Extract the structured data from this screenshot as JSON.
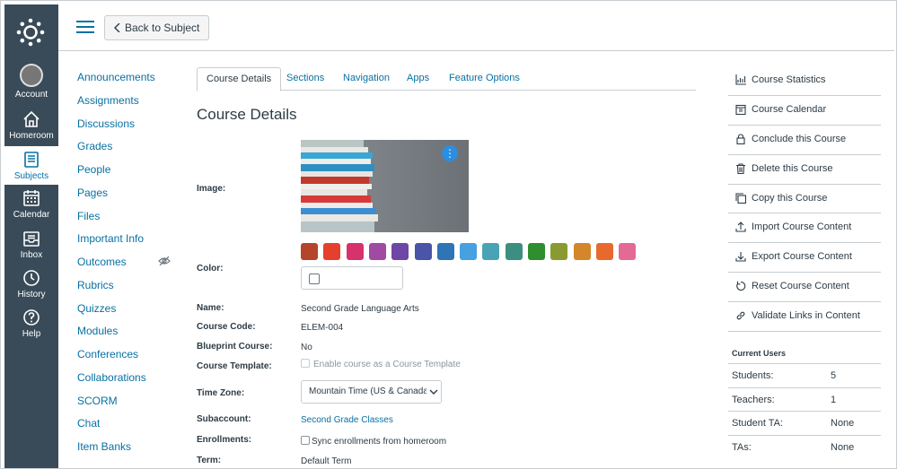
{
  "global_nav": {
    "items": [
      {
        "label": "Account",
        "icon": "avatar"
      },
      {
        "label": "Homeroom",
        "icon": "home-icon"
      },
      {
        "label": "Subjects",
        "icon": "book-icon",
        "active": true
      },
      {
        "label": "Calendar",
        "icon": "calendar-icon"
      },
      {
        "label": "Inbox",
        "icon": "inbox-icon"
      },
      {
        "label": "History",
        "icon": "clock-icon"
      },
      {
        "label": "Help",
        "icon": "help-icon"
      }
    ],
    "colors": {
      "background": "#394b58",
      "active_text": "#0770a3"
    }
  },
  "topbar": {
    "back_label": "Back to Subject"
  },
  "course_nav": [
    "Announcements",
    "Assignments",
    "Discussions",
    "Grades",
    "People",
    "Pages",
    "Files",
    "Important Info",
    "Outcomes",
    "Rubrics",
    "Quizzes",
    "Modules",
    "Conferences",
    "Collaborations",
    "SCORM",
    "Chat",
    "Item Banks"
  ],
  "tabs": [
    "Course Details",
    "Sections",
    "Navigation",
    "Apps",
    "Feature Options"
  ],
  "page_title": "Course Details",
  "form": {
    "image_label": "Image:",
    "color_label": "Color:",
    "swatches": [
      "#b5452a",
      "#e5402e",
      "#d6336c",
      "#a14aa3",
      "#6e46a5",
      "#4a55a8",
      "#2f74b4",
      "#47a0e0",
      "#4aa3b5",
      "#3b8f80",
      "#2f8f2f",
      "#8b9a30",
      "#d4862a",
      "#e8692e",
      "#e46a96"
    ],
    "name_label": "Name:",
    "name_value": "Second Grade Language Arts",
    "code_label": "Course Code:",
    "code_value": "ELEM-004",
    "blueprint_label": "Blueprint Course:",
    "blueprint_value": "No",
    "template_label": "Course Template:",
    "template_checkbox": "Enable course as a Course Template",
    "timezone_label": "Time Zone:",
    "timezone_value": "Mountain Time (US & Canada)",
    "subaccount_label": "Subaccount:",
    "subaccount_value": "Second Grade Classes",
    "enrollments_label": "Enrollments:",
    "enrollments_checkbox": "Sync enrollments from homeroom",
    "term_label": "Term:",
    "term_value": "Default Term"
  },
  "sidebar_actions": [
    {
      "label": "Course Statistics",
      "icon": "bar-chart-icon"
    },
    {
      "label": "Course Calendar",
      "icon": "calendar-icon"
    },
    {
      "label": "Conclude this Course",
      "icon": "lock-icon"
    },
    {
      "label": "Delete this Course",
      "icon": "trash-icon"
    },
    {
      "label": "Copy this Course",
      "icon": "copy-icon"
    },
    {
      "label": "Import Course Content",
      "icon": "upload-icon"
    },
    {
      "label": "Export Course Content",
      "icon": "download-icon"
    },
    {
      "label": "Reset Course Content",
      "icon": "reset-icon"
    },
    {
      "label": "Validate Links in Content",
      "icon": "link-icon"
    }
  ],
  "current_users": {
    "title": "Current Users",
    "rows": [
      {
        "label": "Students:",
        "value": "5"
      },
      {
        "label": "Teachers:",
        "value": "1"
      },
      {
        "label": "Student TA:",
        "value": "None"
      },
      {
        "label": "TAs:",
        "value": "None"
      }
    ]
  }
}
